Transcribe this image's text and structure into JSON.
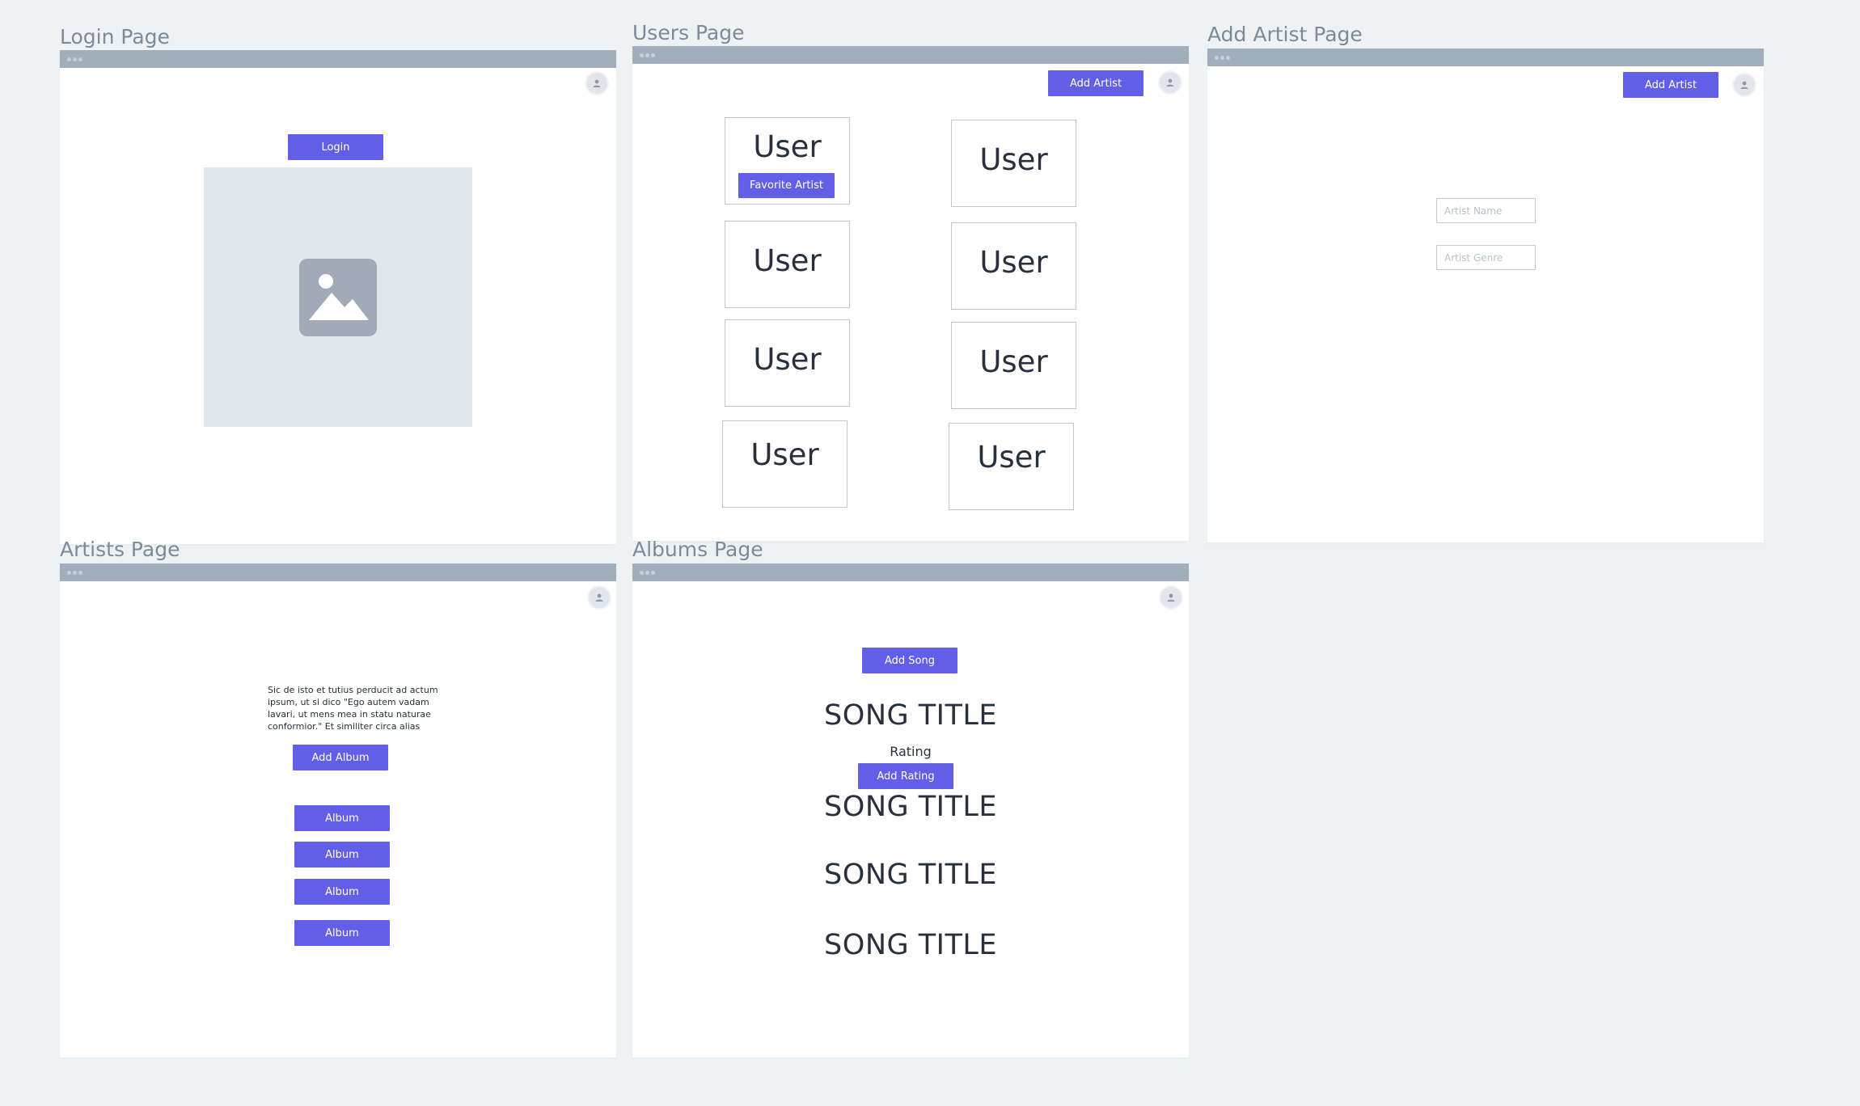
{
  "frames": {
    "login": {
      "title": "Login Page",
      "login_button": "Login"
    },
    "users": {
      "title": "Users Page",
      "add_artist_button": "Add Artist",
      "cards": [
        {
          "label": "User",
          "action": "Favorite Artist"
        },
        {
          "label": "User"
        },
        {
          "label": "User"
        },
        {
          "label": "User"
        },
        {
          "label": "User"
        },
        {
          "label": "User"
        },
        {
          "label": "User"
        },
        {
          "label": "User"
        }
      ]
    },
    "add_artist": {
      "title": "Add Artist Page",
      "add_artist_button": "Add Artist",
      "artist_name_placeholder": "Artist Name",
      "artist_genre_placeholder": "Artist Genre"
    },
    "artists": {
      "title": "Artists Page",
      "description_lines": [
        "Sic de isto et tutius perducit ad actum",
        "ipsum, ut si dico \"Ego autem vadam",
        "lavari, ut mens mea in statu naturae",
        "conformior.\" Et similiter circa alias"
      ],
      "add_album_button": "Add Album",
      "albums": [
        "Album",
        "Album",
        "Album",
        "Album"
      ]
    },
    "albums": {
      "title": "Albums Page",
      "add_song_button": "Add Song",
      "songs": [
        "SONG TITLE",
        "SONG TITLE",
        "SONG TITLE",
        "SONG TITLE"
      ],
      "rating_label": "Rating",
      "add_rating_button": "Add Rating"
    }
  },
  "icons": {
    "avatar": "user-avatar-icon",
    "image": "image-placeholder-icon"
  },
  "colors": {
    "canvas": "#eff2f5",
    "titlebar": "#a1aebb",
    "accent": "#635ee7",
    "frame_title": "#7d8a98",
    "text": "#27303c"
  }
}
